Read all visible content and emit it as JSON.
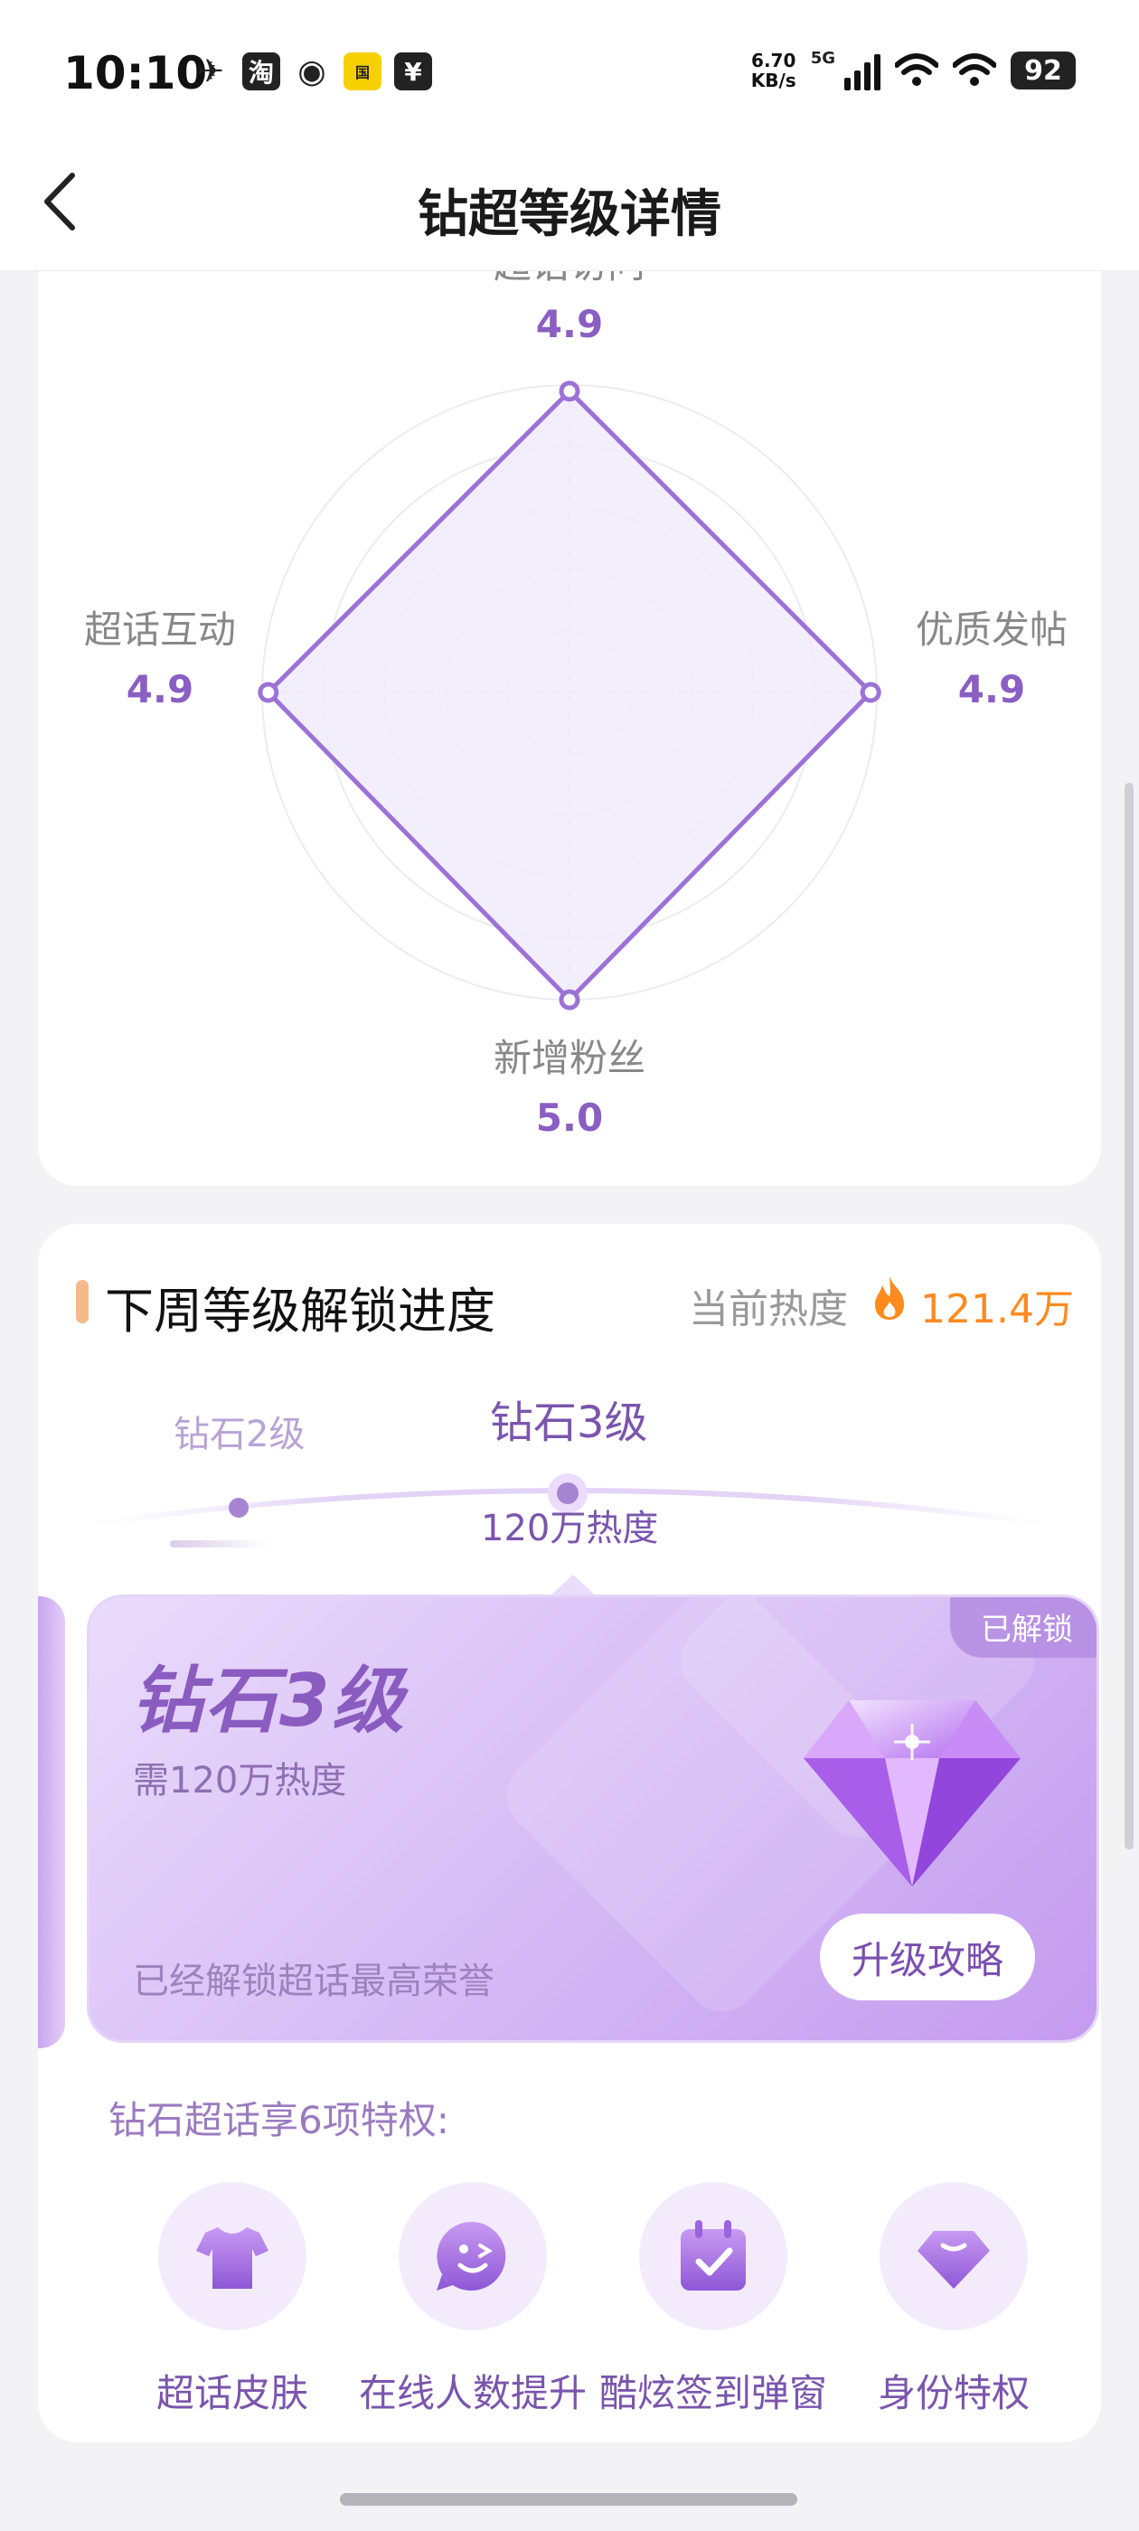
{
  "status_bar": {
    "time": "10:10",
    "apps": [
      "淘",
      "国"
    ],
    "speed_top": "6.70",
    "speed_bottom": "KB/s",
    "network": "5G",
    "battery": "92"
  },
  "header": {
    "title": "钻超等级详情"
  },
  "radar": {
    "max_value": 5.0,
    "axes": [
      {
        "label": "超话访问",
        "value": "4.9",
        "score": 4.9
      },
      {
        "label": "优质发帖",
        "value": "4.9",
        "score": 4.9
      },
      {
        "label": "新增粉丝",
        "value": "5.0",
        "score": 5.0
      },
      {
        "label": "超话互动",
        "value": "4.9",
        "score": 4.9
      }
    ],
    "colors": {
      "stroke": "#9b72d6",
      "fill": "#f1ebfb",
      "value": "#8a5ec2"
    }
  },
  "progress": {
    "section_title": "下周等级解锁进度",
    "heat_label": "当前热度",
    "heat_value": "121.4万",
    "prev_level": "钻石2级",
    "current_level": "钻石3级",
    "current_requirement": "120万热度",
    "card": {
      "badge": "已解锁",
      "level_name": "钻石3级",
      "requirement": "需120万热度",
      "description": "已经解锁超话最高荣誉",
      "button_label": "升级攻略"
    },
    "perks_title": "钻石超话享6项特权:",
    "perks": [
      {
        "label": "超话皮肤",
        "icon": "tshirt-icon"
      },
      {
        "label": "在线人数提升",
        "icon": "smile-face-icon"
      },
      {
        "label": "酷炫签到弹窗",
        "icon": "calendar-check-icon"
      },
      {
        "label": "身份特权",
        "icon": "diamond-badge-icon"
      }
    ]
  },
  "colors": {
    "accent": "#8a5ec2",
    "heat": "#ff8a1e",
    "bar": "#f6b98a"
  }
}
